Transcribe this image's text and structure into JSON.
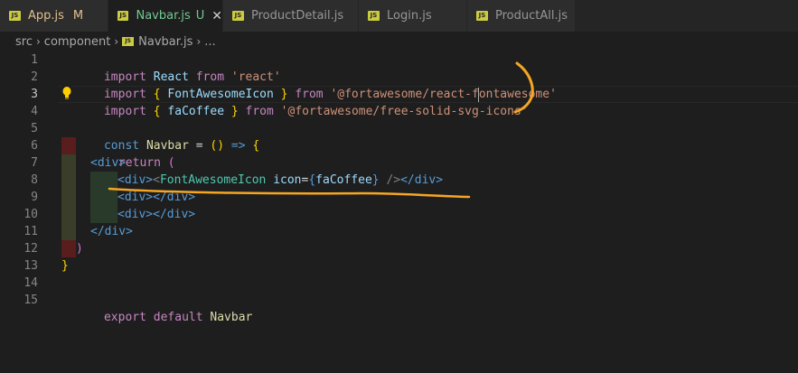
{
  "tabs": [
    {
      "label": "App.js",
      "status": "M",
      "active": false
    },
    {
      "label": "Navbar.js",
      "status": "U",
      "active": true
    },
    {
      "label": "ProductDetail.js",
      "status": "",
      "active": false
    },
    {
      "label": "Login.js",
      "status": "",
      "active": false
    },
    {
      "label": "ProductAll.js",
      "status": "",
      "active": false
    }
  ],
  "breadcrumbs": [
    "src",
    "component",
    "Navbar.js",
    "..."
  ],
  "line_numbers": [
    "1",
    "2",
    "3",
    "4",
    "5",
    "6",
    "7",
    "8",
    "9",
    "10",
    "11",
    "12",
    "13",
    "14",
    "15"
  ],
  "code": {
    "l1": {
      "import": "import",
      "React": "React",
      "from": "from",
      "str": "'react'"
    },
    "l2": {
      "import": "import",
      "open": "{",
      "name": "FontAwesomeIcon",
      "close": "}",
      "from": "from",
      "str": "'@fortawesome/react-fontawesome'"
    },
    "l3": {
      "import": "import",
      "open": "{",
      "name": "faCoffee",
      "close": "}",
      "from": "from",
      "str": "'@fortawesome/free-solid-svg-icons'"
    },
    "l5": {
      "const": "const",
      "name": "Navbar",
      "eq": "=",
      "parens": "()",
      "arrow": "=>",
      "brace": "{"
    },
    "l6": {
      "return": "return",
      "paren": "("
    },
    "l7": {
      "text": "<div>"
    },
    "l8": {
      "open": "<div>",
      "lt": "<",
      "comp": "FontAwesomeIcon",
      "attr": "icon",
      "eq": "=",
      "lb": "{",
      "val": "faCoffee",
      "rb": "}",
      "selfclose": " />",
      "close": "</div>"
    },
    "l9": {
      "text": "<div></div>"
    },
    "l10": {
      "text": "<div></div>"
    },
    "l11": {
      "text": "</div>"
    },
    "l12": {
      "text": ")"
    },
    "l13": {
      "text": "}"
    },
    "l15": {
      "export": "export",
      "default": "default",
      "name": "Navbar"
    }
  },
  "colors": {
    "annotation": "#f5a623",
    "keyword": "#569cd6",
    "string": "#ce9178",
    "variable": "#9cdcfe",
    "component": "#4ec9b0"
  },
  "icons": {
    "lightbulb": "lightbulb-icon",
    "js": "js-file-icon",
    "close": "close-icon",
    "chevron": "chevron-right-icon"
  }
}
